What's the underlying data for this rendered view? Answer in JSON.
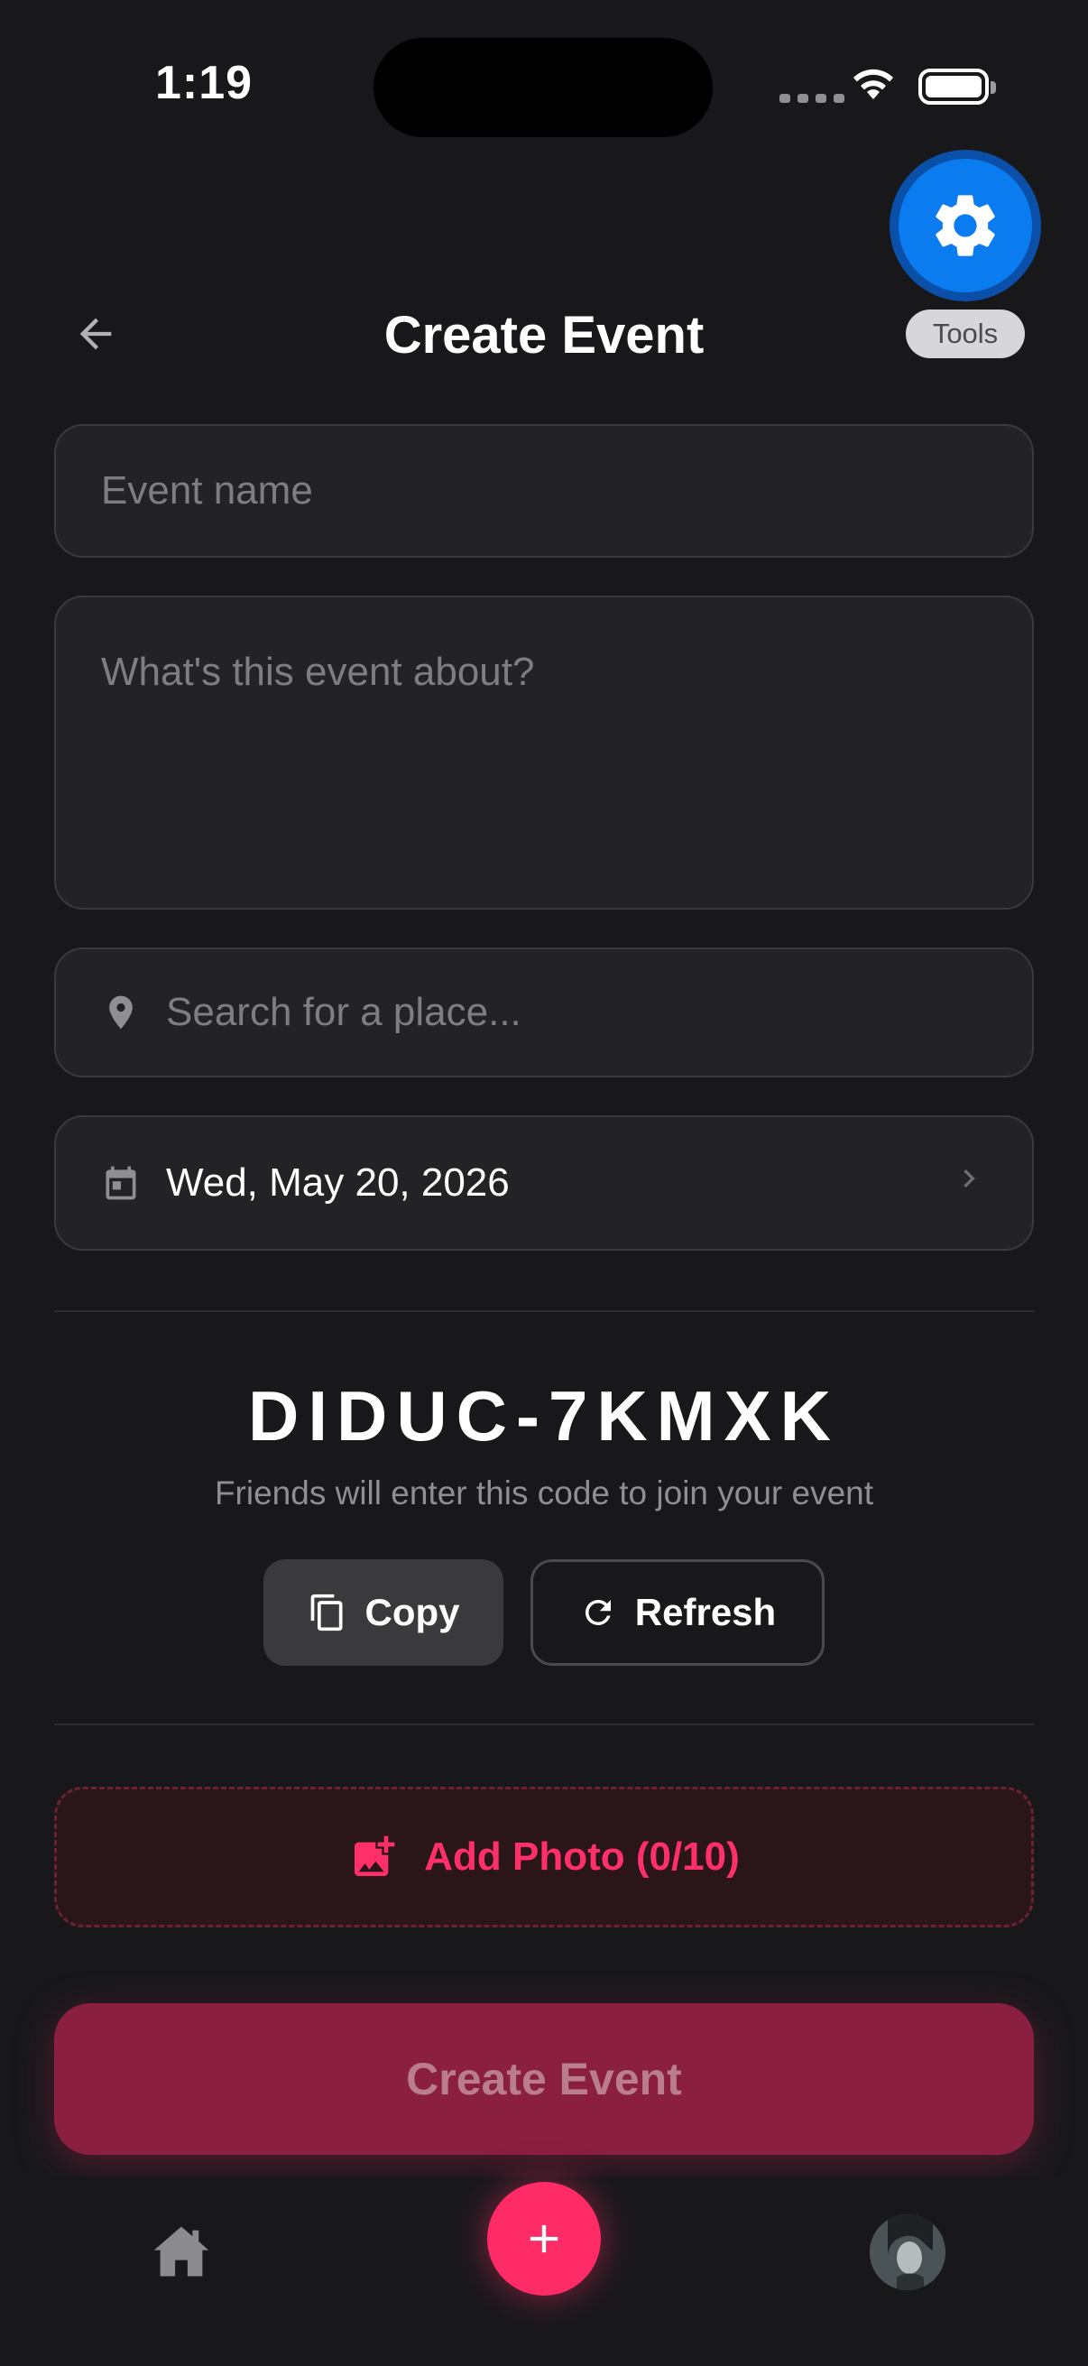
{
  "status_bar": {
    "time": "1:19"
  },
  "tools": {
    "label": "Tools",
    "icon": "gear-icon"
  },
  "header": {
    "title": "Create Event",
    "back_icon": "arrow-left-icon"
  },
  "form": {
    "event_name": {
      "value": "",
      "placeholder": "Event name"
    },
    "description": {
      "value": "",
      "placeholder": "What's this event about?"
    },
    "place": {
      "value": "",
      "placeholder": "Search for a place...",
      "icon": "location-pin-icon"
    },
    "date": {
      "value": "Wed, May 20, 2026",
      "icon": "calendar-icon"
    }
  },
  "join_code": {
    "code": "DIDUC-7KMXK",
    "hint": "Friends will enter this code to join your event",
    "copy_label": "Copy",
    "refresh_label": "Refresh"
  },
  "photos": {
    "label": "Add Photo (0/10)"
  },
  "submit": {
    "label": "Create Event"
  },
  "colors": {
    "background": "#18181b",
    "accent": "#ff2b66",
    "tools_blue": "#0b7cf0",
    "submit_bg": "#8a1f40"
  }
}
